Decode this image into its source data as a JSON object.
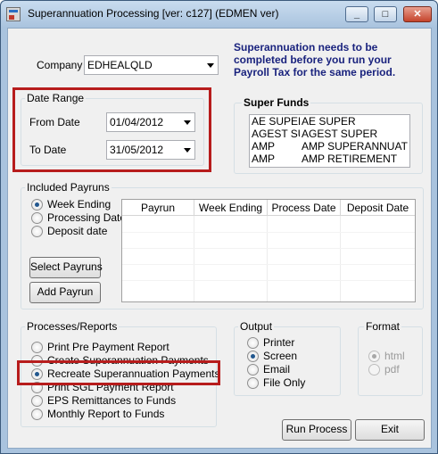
{
  "window": {
    "title": "Superannuation Processing [ver: c127] (EDMEN ver)",
    "min_glyph": "_",
    "max_glyph": "□",
    "close_glyph": "✕"
  },
  "company": {
    "label": "Company",
    "value": "EDHEALQLD"
  },
  "notice": "Superannuation needs to be completed before you run your Payroll Tax for the same period.",
  "date_range": {
    "label": "Date Range",
    "from_label": "From Date",
    "from_value": "01/04/2012",
    "to_label": "To Date",
    "to_value": "31/05/2012"
  },
  "super_funds": {
    "label": "Super Funds",
    "rows": [
      {
        "code": "AE SUPER",
        "name": "AE SUPER"
      },
      {
        "code": "AGEST SUPER",
        "name": "AGEST SUPER"
      },
      {
        "code": "AMP",
        "name": "AMP SUPERANNUATION"
      },
      {
        "code": "AMP",
        "name": "AMP RETIREMENT"
      }
    ]
  },
  "included_payruns": {
    "label": "Included Payruns",
    "options": [
      "Week Ending",
      "Processing Date",
      "Deposit date"
    ],
    "selected": "Week Ending",
    "select_button": "Select Payruns",
    "add_button": "Add Payrun",
    "columns": [
      "Payrun",
      "Week Ending",
      "Process Date",
      "Deposit Date"
    ]
  },
  "processes": {
    "label": "Processes/Reports",
    "options": [
      "Print Pre Payment Report",
      "Create Superannuation Payments",
      "Recreate Superannuation Payments",
      "Print SGL Payment Report",
      "EPS Remittances to Funds",
      "Monthly Report to Funds"
    ],
    "selected": "Recreate Superannuation Payments"
  },
  "output": {
    "label": "Output",
    "options": [
      "Printer",
      "Screen",
      "Email",
      "File Only"
    ],
    "selected": "Screen"
  },
  "format": {
    "label": "Format",
    "options": [
      "html",
      "pdf"
    ],
    "selected": "html"
  },
  "actions": {
    "run": "Run Process",
    "exit": "Exit"
  },
  "colors": {
    "annotation": "#b71c1c",
    "notice_text": "#1a237e",
    "radio_selected": "#22578e"
  }
}
